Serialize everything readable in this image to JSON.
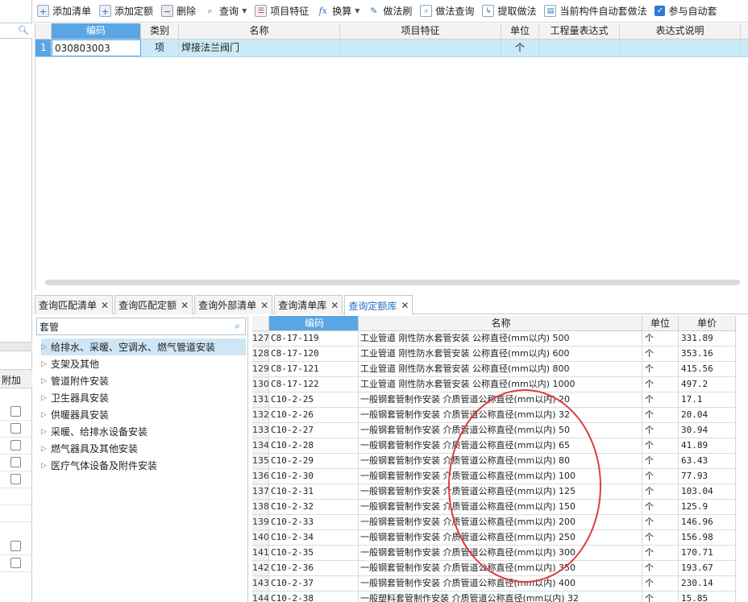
{
  "toolbar": {
    "add_list": "添加清单",
    "add_quota": "添加定额",
    "delete": "删除",
    "query": "查询",
    "item_feature": "项目特征",
    "convert": "换算",
    "method_brush": "做法刷",
    "method_query": "做法查询",
    "extract_method": "提取做法",
    "auto_apply": "当前构件自动套做法",
    "join_auto": "参与自动套"
  },
  "top_grid": {
    "headers": [
      "编码",
      "类别",
      "名称",
      "项目特征",
      "单位",
      "工程量表达式",
      "表达式说明"
    ],
    "row": {
      "index": "1",
      "code": "030803003",
      "type": "项",
      "name": "焊接法兰阀门",
      "feature": "",
      "unit": "个",
      "expr": "",
      "desc": ""
    }
  },
  "tabs": [
    {
      "label": "查询匹配清单",
      "active": false
    },
    {
      "label": "查询匹配定额",
      "active": false
    },
    {
      "label": "查询外部清单",
      "active": false
    },
    {
      "label": "查询清单库",
      "active": false
    },
    {
      "label": "查询定额库",
      "active": true
    }
  ],
  "left_strip": {
    "header": "附加"
  },
  "tree": {
    "search_value": "套管",
    "items": [
      {
        "label": "给排水、采暖、空调水、燃气管道安装",
        "selected": true
      },
      {
        "label": "支架及其他",
        "selected": false
      },
      {
        "label": "管道附件安装",
        "selected": false
      },
      {
        "label": "卫生器具安装",
        "selected": false
      },
      {
        "label": "供暖器具安装",
        "selected": false
      },
      {
        "label": "采暖、给排水设备安装",
        "selected": false
      },
      {
        "label": "燃气器具及其他安装",
        "selected": false
      },
      {
        "label": "医疗气体设备及附件安装",
        "selected": false
      }
    ]
  },
  "grid": {
    "headers": {
      "code": "编码",
      "name": "名称",
      "unit": "单位",
      "price": "单价"
    },
    "rows": [
      {
        "n": "127",
        "code": "C8-17-119",
        "name": "工业管道 刚性防水套管安装 公称直径(mm以内) 500",
        "unit": "个",
        "price": "331.89"
      },
      {
        "n": "128",
        "code": "C8-17-120",
        "name": "工业管道 刚性防水套管安装 公称直径(mm以内) 600",
        "unit": "个",
        "price": "353.16"
      },
      {
        "n": "129",
        "code": "C8-17-121",
        "name": "工业管道 刚性防水套管安装 公称直径(mm以内) 800",
        "unit": "个",
        "price": "415.56"
      },
      {
        "n": "130",
        "code": "C8-17-122",
        "name": "工业管道 刚性防水套管安装 公称直径(mm以内) 1000",
        "unit": "个",
        "price": "497.2"
      },
      {
        "n": "131",
        "code": "C10-2-25",
        "name": "一般钢套管制作安装 介质管道公称直径(mm以内) 20",
        "unit": "个",
        "price": "17.1"
      },
      {
        "n": "132",
        "code": "C10-2-26",
        "name": "一般钢套管制作安装 介质管道公称直径(mm以内) 32",
        "unit": "个",
        "price": "20.04"
      },
      {
        "n": "133",
        "code": "C10-2-27",
        "name": "一般钢套管制作安装 介质管道公称直径(mm以内) 50",
        "unit": "个",
        "price": "30.94"
      },
      {
        "n": "134",
        "code": "C10-2-28",
        "name": "一般钢套管制作安装 介质管道公称直径(mm以内) 65",
        "unit": "个",
        "price": "41.89"
      },
      {
        "n": "135",
        "code": "C10-2-29",
        "name": "一般钢套管制作安装 介质管道公称直径(mm以内) 80",
        "unit": "个",
        "price": "63.43"
      },
      {
        "n": "136",
        "code": "C10-2-30",
        "name": "一般钢套管制作安装 介质管道公称直径(mm以内) 100",
        "unit": "个",
        "price": "77.93"
      },
      {
        "n": "137",
        "code": "C10-2-31",
        "name": "一般钢套管制作安装 介质管道公称直径(mm以内) 125",
        "unit": "个",
        "price": "103.04"
      },
      {
        "n": "138",
        "code": "C10-2-32",
        "name": "一般钢套管制作安装 介质管道公称直径(mm以内) 150",
        "unit": "个",
        "price": "125.9"
      },
      {
        "n": "139",
        "code": "C10-2-33",
        "name": "一般钢套管制作安装 介质管道公称直径(mm以内) 200",
        "unit": "个",
        "price": "146.96"
      },
      {
        "n": "140",
        "code": "C10-2-34",
        "name": "一般钢套管制作安装 介质管道公称直径(mm以内) 250",
        "unit": "个",
        "price": "156.98"
      },
      {
        "n": "141",
        "code": "C10-2-35",
        "name": "一般钢套管制作安装 介质管道公称直径(mm以内) 300",
        "unit": "个",
        "price": "170.71"
      },
      {
        "n": "142",
        "code": "C10-2-36",
        "name": "一般钢套管制作安装 介质管道公称直径(mm以内) 350",
        "unit": "个",
        "price": "193.67"
      },
      {
        "n": "143",
        "code": "C10-2-37",
        "name": "一般钢套管制作安装 介质管道公称直径(mm以内) 400",
        "unit": "个",
        "price": "230.14"
      },
      {
        "n": "144",
        "code": "C10-2-38",
        "name": "一般塑料套管制作安装 介质管道公称直径(mm以内) 32",
        "unit": "个",
        "price": "15.85"
      }
    ]
  },
  "colors": {
    "accent": "#2a70c8",
    "selection": "#cbeaf7",
    "header_highlight": "#5aa5e4",
    "annotation": "#e03c3c"
  }
}
